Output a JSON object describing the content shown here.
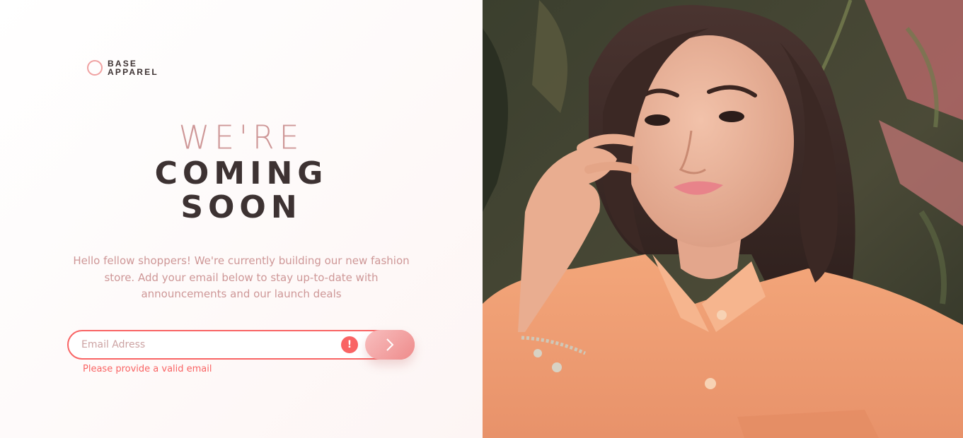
{
  "brand": {
    "line1": "BASE",
    "line2": "APPAREL"
  },
  "headline": {
    "line1": "WE'RE",
    "line2": "COMING",
    "line3": "SOON"
  },
  "description": "Hello fellow shoppers! We're currently building our new fashion store. Add your email below to stay up-to-date with announcements and our launch deals",
  "form": {
    "email_value": "",
    "email_placeholder": "Email Adress",
    "error_icon_glyph": "!",
    "error_message": "Please provide a valid email",
    "submit_icon": "chevron-right-icon"
  },
  "hero_image": {
    "subject": "woman-portrait-photo"
  },
  "colors": {
    "accent_pink": "#ce9797",
    "dark_text": "#3d3232",
    "error_red": "#f96464",
    "button_gradient_start": "#f8bfbf",
    "button_gradient_end": "#ee8b8b"
  }
}
